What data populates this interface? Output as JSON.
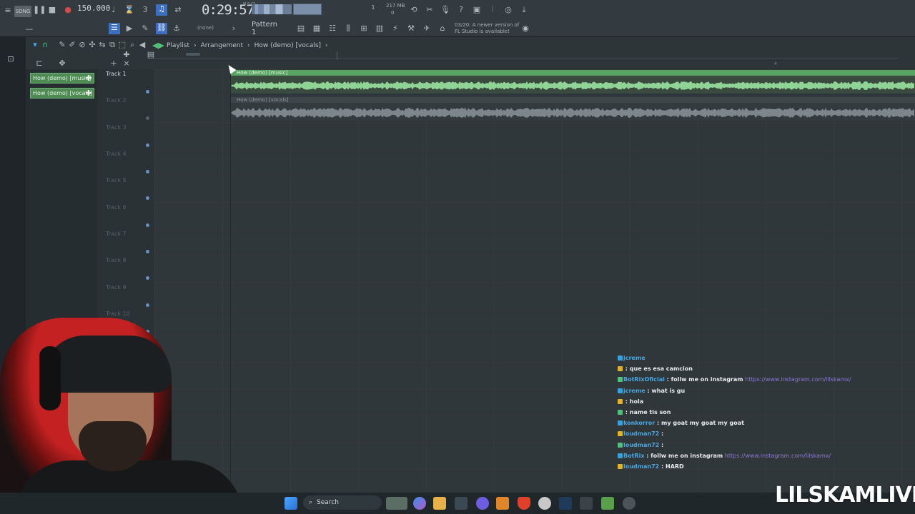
{
  "toolbar": {
    "song_label": "SONG",
    "bpm": "150.000",
    "time": "0:29:57",
    "time_suffix": "M:S:CS",
    "cpu": "217 MB",
    "cpu_sub": "1",
    "cpu_sub2": "0",
    "pattern_selector": "(none)",
    "pattern_name": "Pattern 1",
    "news": [
      "03/20: A newer version of",
      "FL Studio is available!"
    ]
  },
  "playlist": {
    "breadcrumb": [
      "Playlist",
      "Arrangement",
      "How (demo) [vocals]"
    ],
    "bar_marker": "4",
    "clip_picker": [
      "How (demo) [music]",
      "How (demo) [vocals]"
    ],
    "tracks": [
      "Track 1",
      "Track 2",
      "Track 3",
      "Track 4",
      "Track 5",
      "Track 6",
      "Track 7",
      "Track 8",
      "Track 9",
      "Track 10"
    ],
    "clips": [
      {
        "name": "How (demo) [music]",
        "track": 1,
        "color": "#5aa463"
      },
      {
        "name": "How (demo) [vocals]",
        "track": 2,
        "color": "#3f4649"
      }
    ]
  },
  "chat": [
    {
      "user": "jcreme",
      "text": ""
    },
    {
      "user": "",
      "text": ": que es esa camcion"
    },
    {
      "user": "BotRixOficial",
      "text": ": follw me on instagram",
      "link": "https://www.instagram.com/lilskamx/"
    },
    {
      "user": "jcreme",
      "text": ": what is gu"
    },
    {
      "user": "",
      "text": ": hola"
    },
    {
      "user": "",
      "text": ": name tis son"
    },
    {
      "user": "konkorror",
      "text": ": my goat my goat my goat"
    },
    {
      "user": "loudman72",
      "text": ":"
    },
    {
      "user": "loudman72",
      "text": ":"
    },
    {
      "user": "BotRix",
      "text": ": follw me on instagram",
      "link": "https://www.instagram.com/lilskamx/"
    },
    {
      "user": "loudman72",
      "text": ": HARD"
    }
  ],
  "taskbar": {
    "search_label": "Search"
  },
  "overlay": {
    "watermark": "LILSKAMLIVE"
  }
}
